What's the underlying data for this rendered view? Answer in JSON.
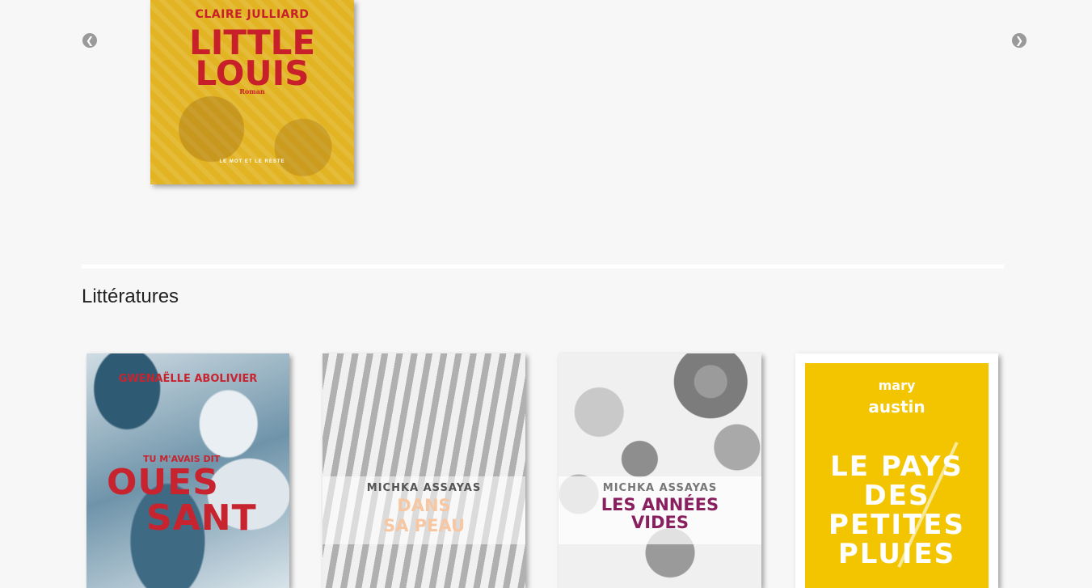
{
  "carousel": {
    "prev_icon": "chevron-left-circle-icon",
    "next_icon": "chevron-right-circle-icon",
    "prev_glyph": "❮",
    "next_glyph": "❯",
    "quote_glyph": "”",
    "featured": {
      "author": "CLAIRE JULLIARD",
      "title_line1": "LITTLE",
      "title_line2": "LOUIS",
      "genre": "Roman",
      "publisher": "LE MOT ET LE RESTE",
      "cover_color": "#e2b423",
      "text_color": "#c8202b"
    }
  },
  "section": {
    "title": "Littératures"
  },
  "books": [
    {
      "author": "GWENAËLLE ABOLIVIER",
      "pre_title": "TU M'AVAIS DIT",
      "title_line1": "OUES",
      "title_line2": "SANT",
      "accent": "#c8242f"
    },
    {
      "author": "MICHKA ASSAYAS",
      "title_line1": "DANS",
      "title_line2": "SA PEAU",
      "accent": "#f6c7a2"
    },
    {
      "author": "MICHKA ASSAYAS",
      "title_line1": "LES ANNÉES",
      "title_line2": "VIDES",
      "accent": "#8a1f5f"
    },
    {
      "author_first": "mary",
      "author_last": "austin",
      "title_line1": "LE PAYS",
      "title_line2": "DES",
      "title_line3": "PETITES",
      "title_line4": "PLUIES",
      "accent": "#f2c500"
    }
  ]
}
